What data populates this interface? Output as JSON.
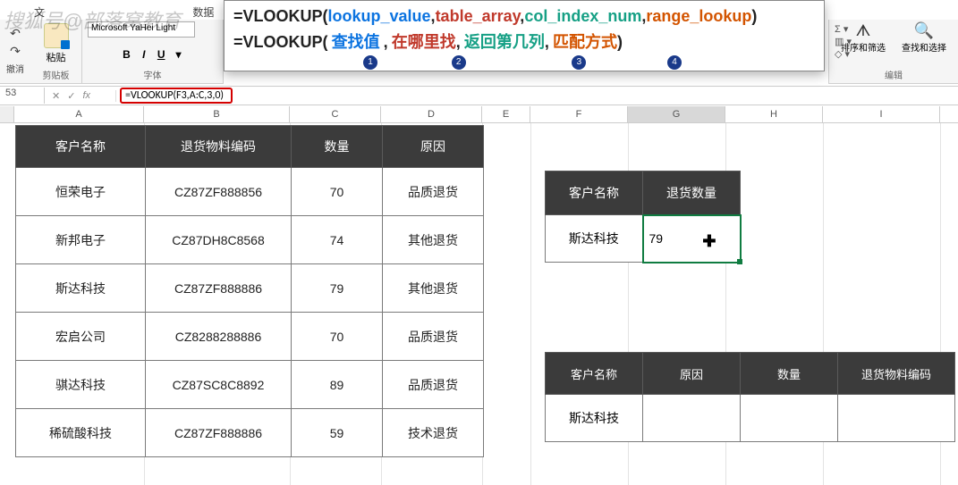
{
  "watermark": "搜狐号@部落窝教育",
  "qat_undo_label": "撤消",
  "menu": {
    "file": "文",
    "data": "数据"
  },
  "ribbon": {
    "paste": "粘贴",
    "clipboard_label": "剪贴板",
    "font_name": "Microsoft YaHei Light",
    "bold": "B",
    "italic": "I",
    "underline": "U",
    "font_label": "字体",
    "sigma": "Σ",
    "sort_filter": "排序和筛选",
    "find_select": "查找和选择",
    "edit_label": "编辑"
  },
  "formula_help": {
    "fn": "=VLOOKUP(",
    "a1": "lookup_value",
    "a2": "table_array",
    "a3": "col_index_num",
    "a4": "range_lookup",
    "cn1": "查找值",
    "cn2": "在哪里找",
    "cn3": "返回第几列",
    "cn4": "匹配方式",
    "b1": "1",
    "b2": "2",
    "b3": "3",
    "b4": "4"
  },
  "formula_bar": {
    "name": "53",
    "fx": "fx",
    "formula": "=VLOOKUP(F3,A:C,3,0)"
  },
  "columns": [
    "A",
    "B",
    "C",
    "D",
    "E",
    "F",
    "G",
    "H",
    "I"
  ],
  "main_table": {
    "headers": [
      "客户名称",
      "退货物料编码",
      "数量",
      "原因"
    ],
    "rows": [
      [
        "恒荣电子",
        "CZ87ZF888856",
        "70",
        "品质退货"
      ],
      [
        "新邦电子",
        "CZ87DH8C8568",
        "74",
        "其他退货"
      ],
      [
        "斯达科技",
        "CZ87ZF888886",
        "79",
        "其他退货"
      ],
      [
        "宏启公司",
        "CZ8288288886",
        "70",
        "品质退货"
      ],
      [
        "骐达科技",
        "CZ87SC8C8892",
        "89",
        "品质退货"
      ],
      [
        "稀硫酸科技",
        "CZ87ZF888886",
        "59",
        "技术退货"
      ]
    ]
  },
  "lookup1": {
    "headers": [
      "客户名称",
      "退货数量"
    ],
    "customer": "斯达科技",
    "result": "79"
  },
  "lookup2": {
    "headers": [
      "客户名称",
      "原因",
      "数量",
      "退货物料编码"
    ],
    "customer": "斯达科技"
  }
}
